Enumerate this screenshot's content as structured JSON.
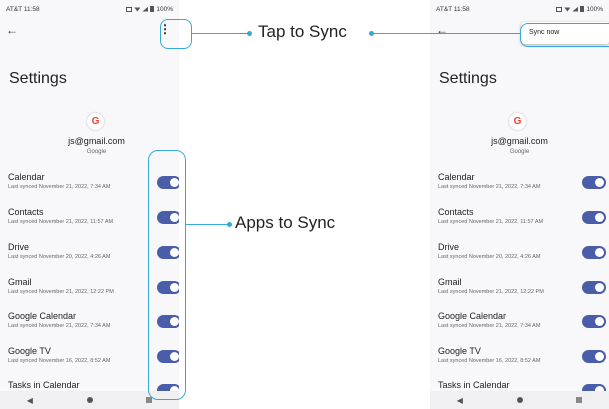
{
  "left": {
    "status": {
      "carrier_time": "AT&T 11:58",
      "battery": "100%"
    },
    "title": "Settings",
    "google_badge": "G",
    "account": {
      "email": "js@gmail.com",
      "provider": "Google"
    },
    "items": [
      {
        "name": "Calendar",
        "sub": "Last synced November 21, 2022, 7:34 AM"
      },
      {
        "name": "Contacts",
        "sub": "Last synced November 21, 2022, 11:57 AM"
      },
      {
        "name": "Drive",
        "sub": "Last synced November 20, 2022, 4:26 AM"
      },
      {
        "name": "Gmail",
        "sub": "Last synced November 21, 2022, 12:22 PM"
      },
      {
        "name": "Google Calendar",
        "sub": "Last synced November 21, 2022, 7:34 AM"
      },
      {
        "name": "Google TV",
        "sub": "Last synced November 16, 2022, 8:52 AM"
      },
      {
        "name": "Tasks in Calendar",
        "sub": ""
      }
    ]
  },
  "right": {
    "status": {
      "carrier_time": "AT&T 11:58",
      "battery": "100%"
    },
    "menu": {
      "sync_now": "Sync now"
    },
    "title": "Settings",
    "google_badge": "G",
    "account": {
      "email": "js@gmail.com",
      "provider": "Google"
    },
    "items": [
      {
        "name": "Calendar",
        "sub": "Last synced November 21, 2022, 7:34 AM"
      },
      {
        "name": "Contacts",
        "sub": "Last synced November 21, 2022, 11:57 AM"
      },
      {
        "name": "Drive",
        "sub": "Last synced November 20, 2022, 4:26 AM"
      },
      {
        "name": "Gmail",
        "sub": "Last synced November 21, 2022, 12:22 PM"
      },
      {
        "name": "Google Calendar",
        "sub": "Last synced November 21, 2022, 7:34 AM"
      },
      {
        "name": "Google TV",
        "sub": "Last synced November 16, 2022, 8:52 AM"
      },
      {
        "name": "Tasks in Calendar",
        "sub": ""
      }
    ]
  },
  "annotations": {
    "tap_to_sync": "Tap to Sync",
    "apps_to_sync": "Apps to Sync"
  },
  "colors": {
    "accent": "#37a9d9",
    "toggle_on": "#4a5da8"
  },
  "icons": {
    "back": "arrow-left-icon",
    "more": "more-vert-icon"
  }
}
